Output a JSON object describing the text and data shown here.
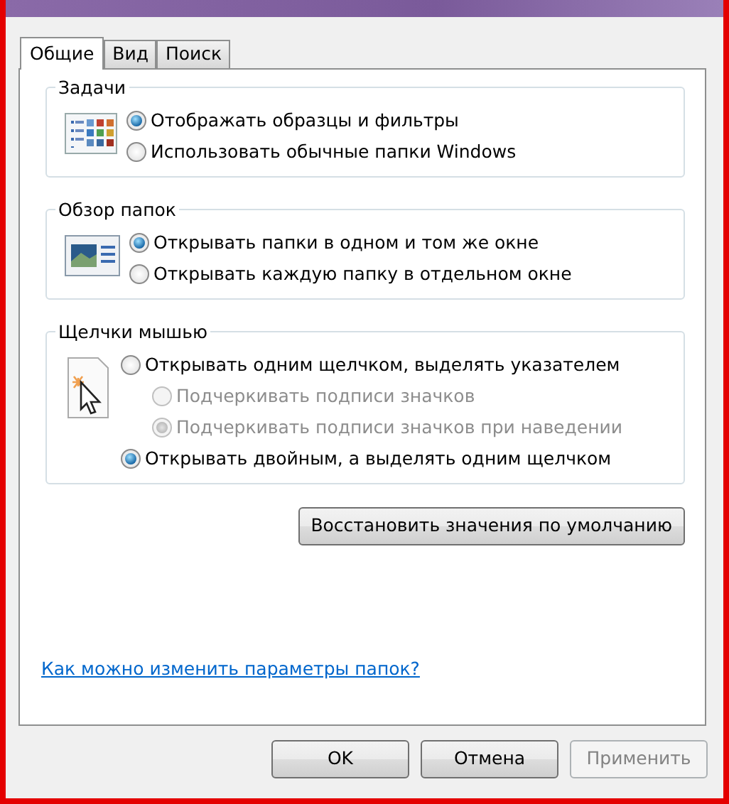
{
  "tabs": [
    {
      "label": "Общие",
      "selected": true
    },
    {
      "label": "Вид",
      "selected": false
    },
    {
      "label": "Поиск",
      "selected": false
    }
  ],
  "groups": [
    {
      "title": "Задачи",
      "options": [
        {
          "label": "Отображать образцы и фильтры",
          "selected": true,
          "disabled": false,
          "indent": false
        },
        {
          "label": "Использовать обычные папки Windows",
          "selected": false,
          "disabled": false,
          "indent": false
        }
      ]
    },
    {
      "title": "Обзор папок",
      "options": [
        {
          "label": "Открывать папки в одном и том же окне",
          "selected": true,
          "disabled": false,
          "indent": false
        },
        {
          "label": "Открывать каждую папку в отдельном окне",
          "selected": false,
          "disabled": false,
          "indent": false
        }
      ]
    },
    {
      "title": "Щелчки мышью",
      "options": [
        {
          "label": "Открывать одним щелчком, выделять указателем",
          "selected": false,
          "disabled": false,
          "indent": false
        },
        {
          "label": "Подчеркивать подписи значков",
          "selected": false,
          "disabled": true,
          "indent": true
        },
        {
          "label": "Подчеркивать подписи значков при наведении",
          "selected": true,
          "disabled": true,
          "indent": true
        },
        {
          "label": "Открывать двойным, а выделять одним щелчком",
          "selected": true,
          "disabled": false,
          "indent": false
        }
      ]
    }
  ],
  "restore_button": {
    "label": "Восстановить значения по умолчанию"
  },
  "help_link": "Как можно изменить параметры папок?",
  "buttons": [
    {
      "label": "OK",
      "disabled": false
    },
    {
      "label": "Отмена",
      "disabled": false
    },
    {
      "label": "Применить",
      "disabled": true
    }
  ]
}
